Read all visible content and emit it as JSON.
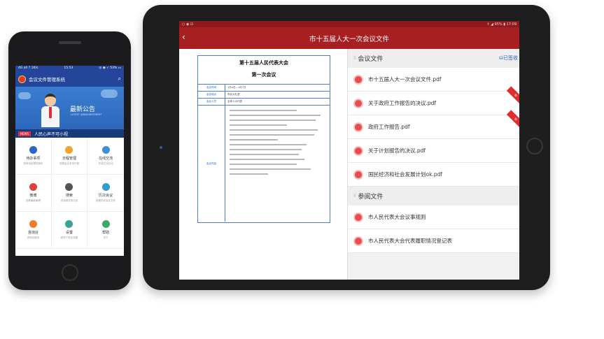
{
  "phone": {
    "status_left": "4G all 7.1K/s",
    "status_time": "15:53",
    "status_right": "◎ ◉ ✓ 53% ▭",
    "app_title": "会议文件管理系统",
    "search_icon": "magnifier",
    "banner_main": "最新公告",
    "banner_sub": "LATEST ANNOUNCEMENT",
    "news_tag": "NEWS",
    "news_text": "人民心声不可小视",
    "grid": [
      {
        "label": "待办事项",
        "desc": "您有待处理的事件",
        "icon": "chart-icon",
        "color": "#2d66c4"
      },
      {
        "label": "日程管理",
        "desc": "查看会议安排日程",
        "icon": "calendar-icon",
        "color": "#f0a62a"
      },
      {
        "label": "在线交流",
        "desc": "在线交流互动",
        "icon": "chat-icon",
        "color": "#3f8fd8"
      },
      {
        "label": "微博",
        "desc": "查看最新微博",
        "icon": "weibo-icon",
        "color": "#e2403a"
      },
      {
        "label": "搜索",
        "desc": "查找相关的内容",
        "icon": "search-icon",
        "color": "#555555"
      },
      {
        "label": "历次会议",
        "desc": "查看历次会议文件",
        "icon": "history-icon",
        "color": "#2f9ec8"
      },
      {
        "label": "咨询台",
        "desc": "咨询台服务",
        "icon": "consult-icon",
        "color": "#ef7c2a"
      },
      {
        "label": "设置",
        "desc": "修改个性化设置",
        "icon": "gear-icon",
        "color": "#3aa38f"
      },
      {
        "label": "帮助",
        "desc": "关于",
        "icon": "help-icon",
        "color": "#3aa86a"
      }
    ]
  },
  "tablet": {
    "status_left": "○ ◉ ⊡",
    "status_right": "⇪ ◢ 95% ▮ 17:09",
    "back_icon": "‹",
    "title": "市十五届人大一次会议文件",
    "doc": {
      "title1": "第十五届人民代表大会",
      "title2": "第一次会议",
      "rows": [
        {
          "key": "会议时间",
          "value": "1月4日—1月7日"
        },
        {
          "key": "会议地点",
          "value": "市民大礼堂"
        },
        {
          "key": "会议人员",
          "value": "全体人大代表"
        }
      ],
      "body_key": "会议内容"
    },
    "sections": [
      {
        "title": "会议文件",
        "signed": "已签收",
        "files": [
          {
            "name": "市十五届人大一次会议文件.pdf",
            "ribbon": ""
          },
          {
            "name": "关于政府工作报告的决议.pdf",
            "ribbon": "新"
          },
          {
            "name": "政府工作报告.pdf",
            "ribbon": "新"
          },
          {
            "name": "关于计划报告的决议.pdf",
            "ribbon": ""
          },
          {
            "name": "国民经济和社会发展计划ok.pdf",
            "ribbon": ""
          }
        ]
      },
      {
        "title": "参阅文件",
        "signed": "",
        "files": [
          {
            "name": "市人民代表大会议事规则",
            "ribbon": ""
          },
          {
            "name": "市人民代表大会代表履职情况登记表",
            "ribbon": ""
          }
        ]
      }
    ]
  },
  "colors": {
    "tablet_header": "#a81f22",
    "phone_header": "#23469a",
    "link": "#2a64c3"
  }
}
